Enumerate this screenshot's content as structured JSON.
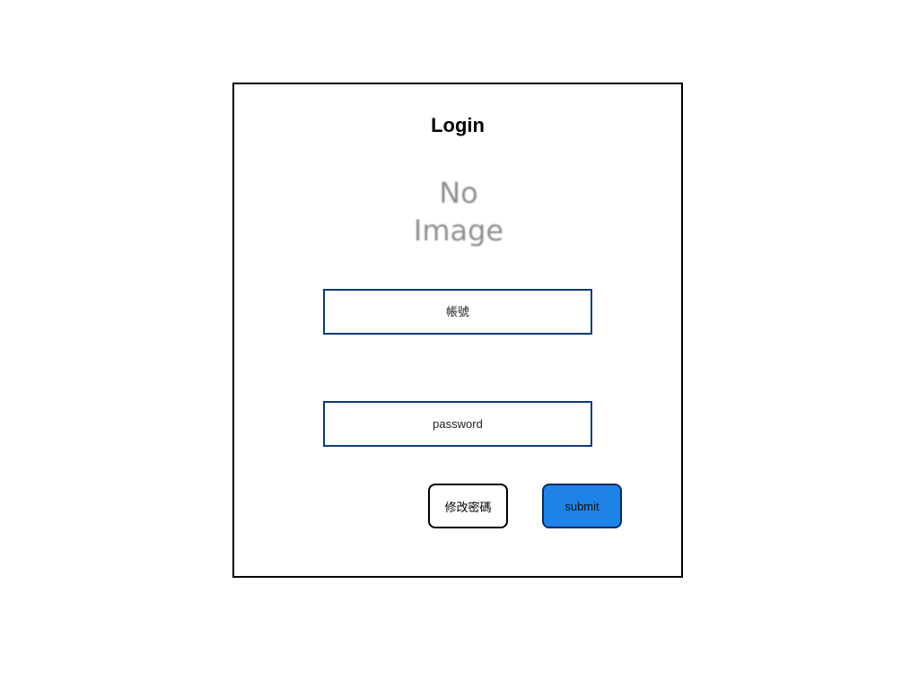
{
  "form": {
    "title": "Login",
    "image_placeholder_line1": "No",
    "image_placeholder_line2": "Image",
    "account_placeholder": "帳號",
    "password_placeholder": "password",
    "change_password_label": "修改密碼",
    "submit_label": "submit"
  },
  "colors": {
    "field_border": "#0d3a74",
    "submit_background": "#1e82e6",
    "submit_border": "#0a2a66"
  }
}
